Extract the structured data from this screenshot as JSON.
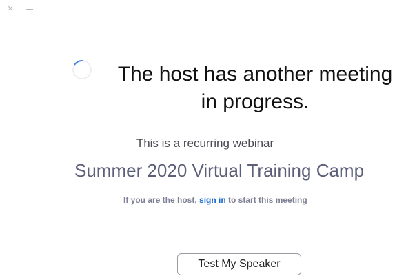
{
  "titlebar": {
    "close_glyph": "×",
    "minimize_icon": "minimize-icon"
  },
  "status": {
    "spinner_icon": "loading-spinner-icon",
    "headline_line1": "The host has another meeting",
    "headline_line2": "in progress."
  },
  "webinar": {
    "subtitle": "This is a recurring webinar",
    "title": "Summer 2020 Virtual Training Camp"
  },
  "host_hint": {
    "prefix": "If you are the host, ",
    "link": "sign in",
    "suffix": " to start this meeting"
  },
  "actions": {
    "test_speaker_label": "Test My Speaker"
  },
  "colors": {
    "link": "#1a6ad1",
    "title": "#5b5f78",
    "hint": "#7d7f93"
  }
}
